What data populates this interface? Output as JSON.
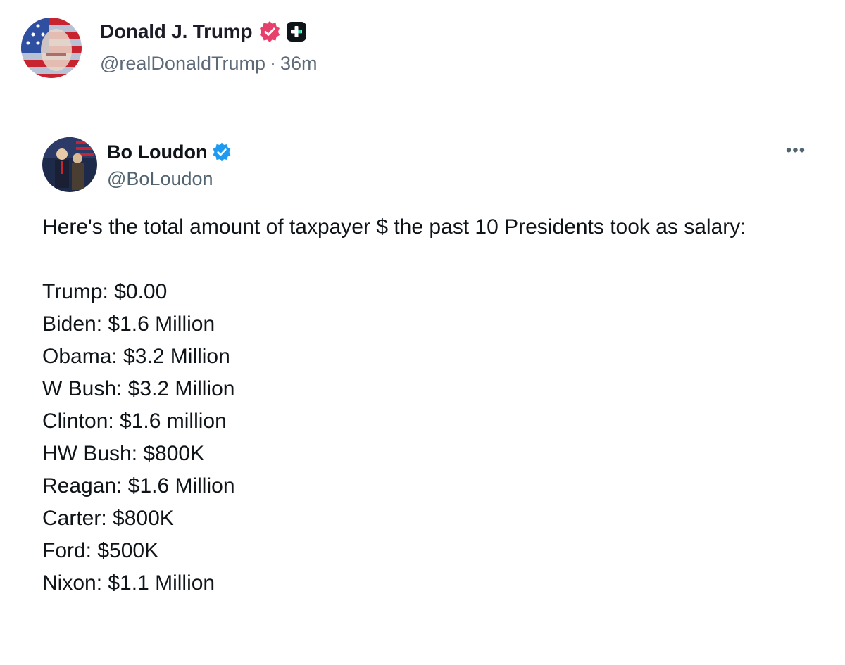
{
  "post": {
    "author_name": "Donald J. Trump",
    "handle": "@realDonaldTrump",
    "separator": "·",
    "time_ago": "36m"
  },
  "quoted_post": {
    "author_name": "Bo Loudon",
    "handle": "@BoLoudon",
    "more_label": "•••",
    "intro_text": "Here's the total amount of taxpayer $ the past 10 Presidents took as salary:",
    "salaries": [
      "Trump: $0.00",
      "Biden: $1.6 Million",
      "Obama: $3.2 Million",
      "W Bush: $3.2 Million",
      "Clinton: $1.6 million",
      "HW Bush: $800K",
      "Reagan: $1.6 Million",
      "Carter: $800K",
      "Ford: $500K",
      "Nixon: $1.1 Million"
    ]
  },
  "icons": {
    "verified_main": "verified-badge-icon",
    "plus_badge": "plus-badge-icon",
    "verified_quote": "verified-badge-icon",
    "more": "more-options-icon"
  },
  "colors": {
    "verified_main": "#e7416b",
    "verified_quote": "#1d9bf0",
    "plus_badge": "#0f1419",
    "meta_text": "#5e6a78"
  }
}
